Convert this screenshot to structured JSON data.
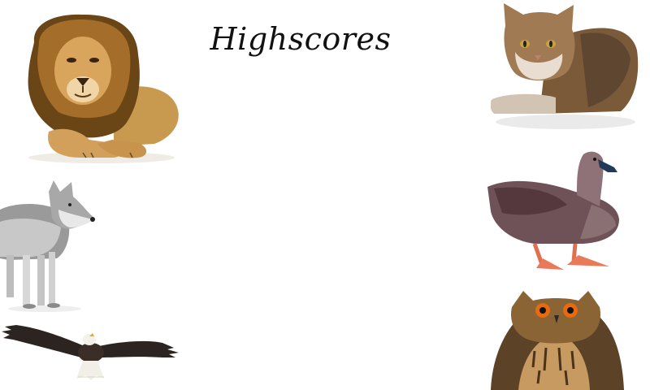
{
  "screen": {
    "title": "Highscores",
    "background": "#ffffff"
  },
  "animals": [
    {
      "name": "lion",
      "side": "left"
    },
    {
      "name": "wolf",
      "side": "left"
    },
    {
      "name": "eagle",
      "side": "left"
    },
    {
      "name": "cat",
      "side": "right"
    },
    {
      "name": "goose",
      "side": "right"
    },
    {
      "name": "owl",
      "side": "right"
    }
  ],
  "highscores": []
}
